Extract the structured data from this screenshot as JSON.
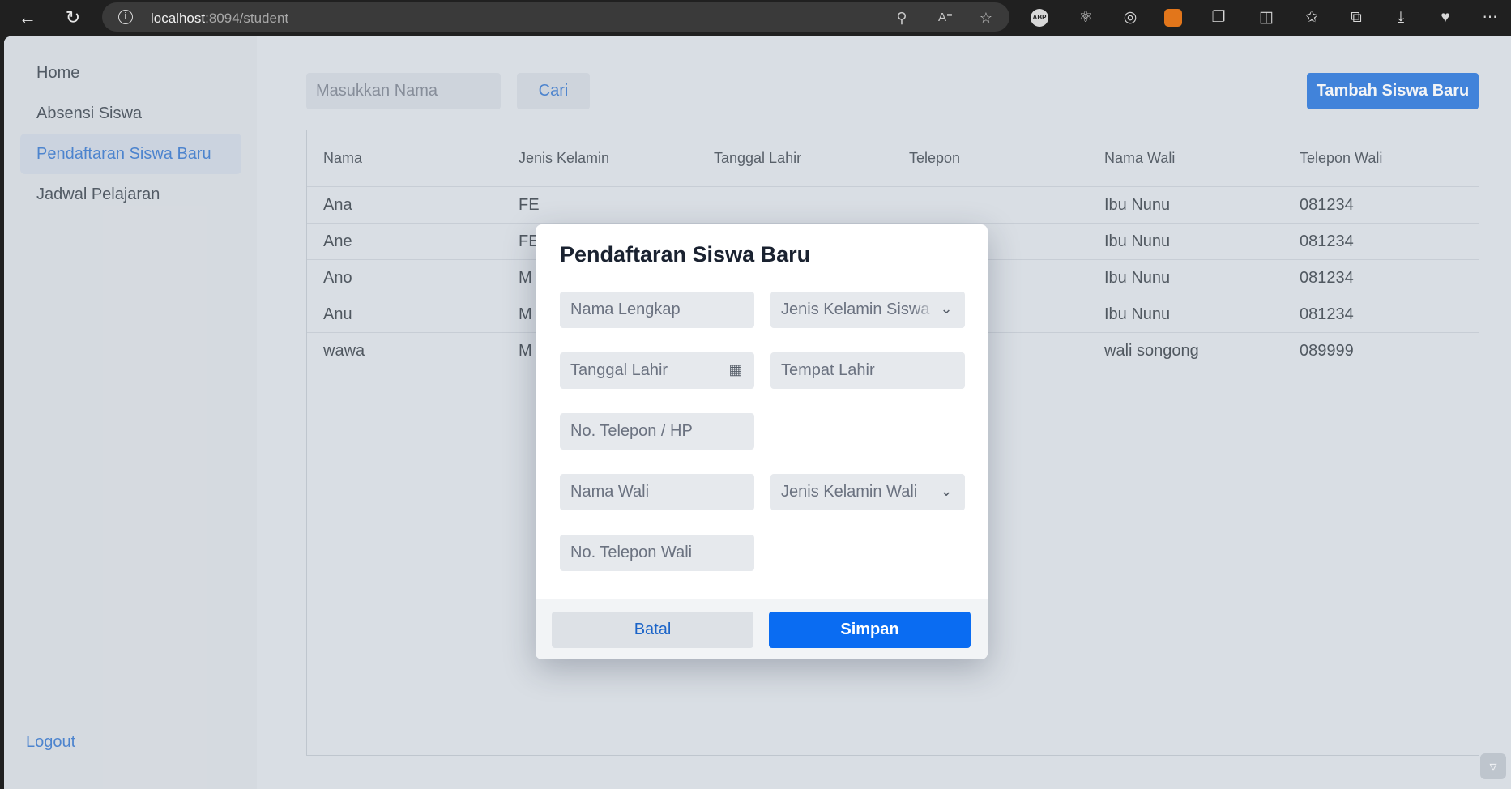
{
  "browser": {
    "url_host": "localhost",
    "url_path": ":8094/student",
    "icons": [
      "back-icon",
      "refresh-icon",
      "info-icon",
      "key-icon",
      "read-aloud-icon",
      "favorite-star-icon",
      "adblock-icon",
      "react-devtools-icon",
      "extension-target-icon",
      "metamask-icon",
      "extensions-icon",
      "split-screen-icon",
      "favorites-icon",
      "collections-icon",
      "downloads-icon",
      "health-icon",
      "more-icon"
    ],
    "abp_label": "ABP"
  },
  "sidebar": {
    "items": [
      {
        "label": "Home"
      },
      {
        "label": "Absensi Siswa"
      },
      {
        "label": "Pendaftaran Siswa Baru",
        "active": true
      },
      {
        "label": "Jadwal Pelajaran"
      }
    ],
    "logout_label": "Logout"
  },
  "toolbar": {
    "search_placeholder": "Masukkan Nama",
    "search_button": "Cari",
    "add_button": "Tambah Siswa Baru"
  },
  "table": {
    "columns": [
      "Nama",
      "Jenis Kelamin",
      "Tanggal Lahir",
      "Telepon",
      "Nama Wali",
      "Telepon Wali"
    ],
    "rows": [
      {
        "nama": "Ana",
        "jk": "FE",
        "wali": "Ibu Nunu",
        "telp_wali": "081234"
      },
      {
        "nama": "Ane",
        "jk": "FE",
        "wali": "Ibu Nunu",
        "telp_wali": "081234"
      },
      {
        "nama": "Ano",
        "jk": "M",
        "wali": "Ibu Nunu",
        "telp_wali": "081234"
      },
      {
        "nama": "Anu",
        "jk": "M",
        "wali": "Ibu Nunu",
        "telp_wali": "081234"
      },
      {
        "nama": "wawa",
        "jk": "M",
        "wali": "wali songong",
        "telp_wali": "089999"
      }
    ]
  },
  "modal": {
    "title": "Pendaftaran Siswa Baru",
    "fields": {
      "nama_lengkap": "Nama Lengkap",
      "jenis_kelamin_siswa": "Jenis Kelamin Siswa",
      "tanggal_lahir": "Tanggal Lahir",
      "tempat_lahir": "Tempat Lahir",
      "telepon": "No. Telepon / HP",
      "nama_wali": "Nama Wali",
      "jenis_kelamin_wali": "Jenis Kelamin Wali",
      "telepon_wali": "No. Telepon Wali"
    },
    "cancel_button": "Batal",
    "save_button": "Simpan"
  },
  "colors": {
    "accent": "#0a63d8",
    "link": "#1b64c8",
    "sidebar_active_bg": "#c9d2df",
    "page_bg": "#dde1e7"
  }
}
